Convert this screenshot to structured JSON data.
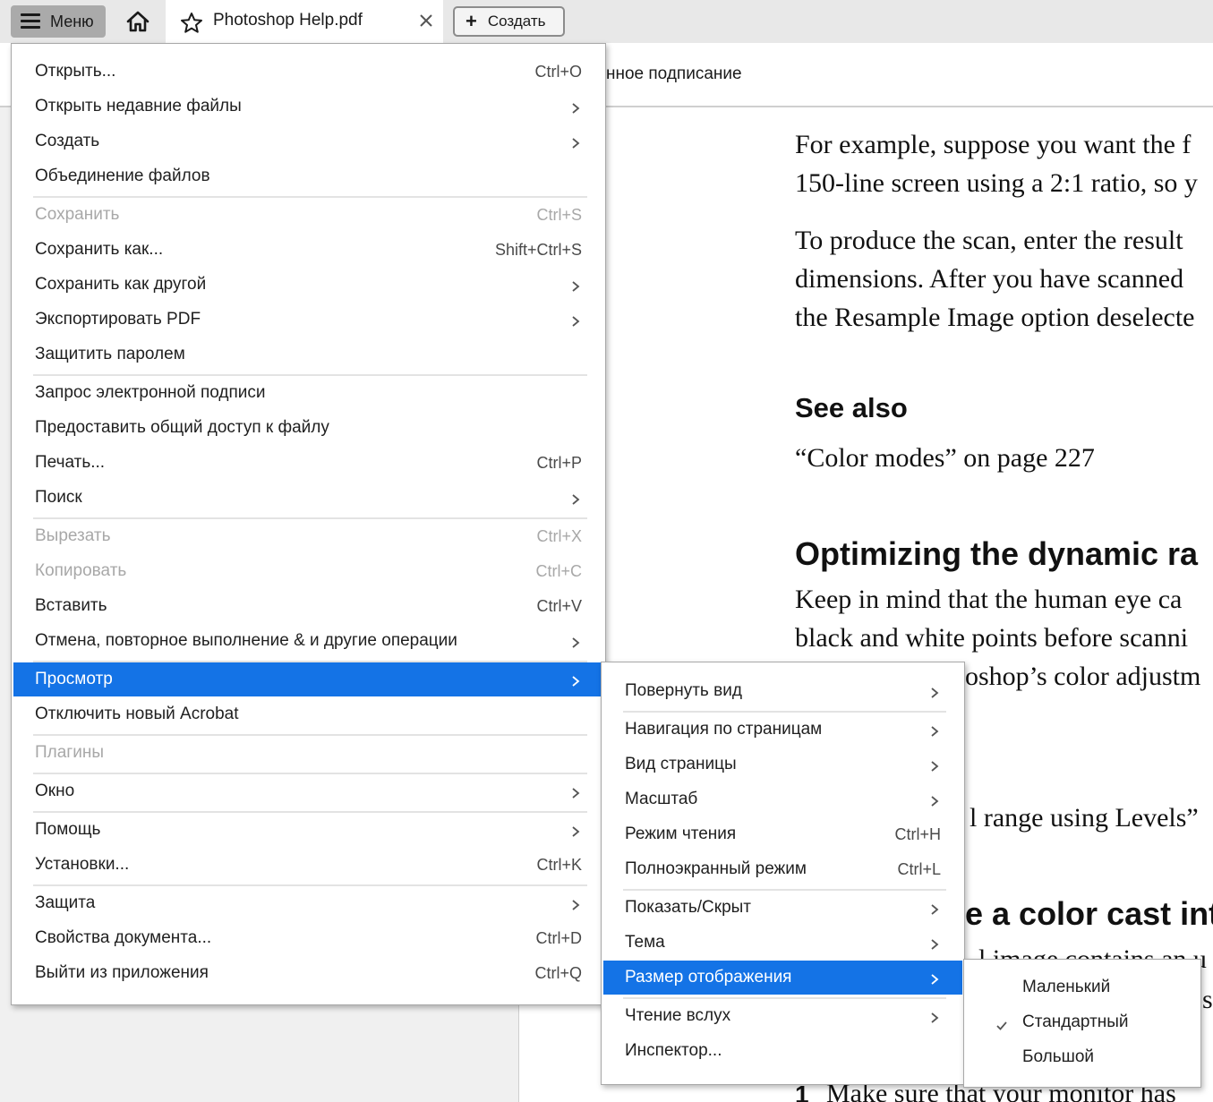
{
  "tabbar": {
    "menu_label": "Меню",
    "document_tab_title": "Photoshop Help.pdf",
    "create_label": "Создать"
  },
  "toolbar": {
    "partial_text": "нное подписание"
  },
  "document": {
    "para1_line1": "For example, suppose you want the f",
    "para1_line2": "150-line screen using a 2:1 ratio, so y",
    "para2_line1": "To produce the scan, enter the result",
    "para2_line2": "dimensions. After you have scanned",
    "para2_line3": "the Resample Image option deselecte",
    "see_also_heading": "See also",
    "see_also_link": "“Color modes” on page 227",
    "heading2": "Optimizing the dynamic ra",
    "para3_line1": "Keep in mind that the human eye ca",
    "para3_line2": "black and white points before scanni",
    "para3_line3": "oshop’s color adjustm",
    "partial_link": "l range using Levels”",
    "heading3_partial": "e a color cast int",
    "partial_line_a": "l image contains an u",
    "partial_line_b": "s",
    "step_number": "1",
    "step_text": "Make sure that your monitor has"
  },
  "main_menu": {
    "items": [
      {
        "label": "Открыть...",
        "shortcut": "Ctrl+O"
      },
      {
        "label": "Открыть недавние файлы",
        "submenu": true
      },
      {
        "label": "Создать",
        "submenu": true
      },
      {
        "label": "Объединение файлов"
      },
      {
        "label": "Сохранить",
        "shortcut": "Ctrl+S",
        "disabled": true
      },
      {
        "label": "Сохранить как...",
        "shortcut": "Shift+Ctrl+S"
      },
      {
        "label": "Сохранить как другой",
        "submenu": true
      },
      {
        "label": "Экспортировать PDF",
        "submenu": true
      },
      {
        "label": "Защитить паролем"
      },
      {
        "label": "Запрос электронной подписи"
      },
      {
        "label": "Предоставить общий доступ к файлу"
      },
      {
        "label": "Печать...",
        "shortcut": "Ctrl+P"
      },
      {
        "label": "Поиск",
        "submenu": true
      },
      {
        "label": "Вырезать",
        "shortcut": "Ctrl+X",
        "disabled": true
      },
      {
        "label": "Копировать",
        "shortcut": "Ctrl+C",
        "disabled": true
      },
      {
        "label": "Вставить",
        "shortcut": "Ctrl+V"
      },
      {
        "label": "Отмена, повторное выполнение & и другие операции",
        "submenu": true
      },
      {
        "label": "Просмотр",
        "submenu": true,
        "active": true
      },
      {
        "label": "Отключить новый Acrobat"
      },
      {
        "label": "Плагины",
        "disabled": true
      },
      {
        "label": "Окно",
        "submenu": true
      },
      {
        "label": "Помощь",
        "submenu": true
      },
      {
        "label": "Установки...",
        "shortcut": "Ctrl+K"
      },
      {
        "label": "Защита",
        "submenu": true
      },
      {
        "label": "Свойства документа...",
        "shortcut": "Ctrl+D"
      },
      {
        "label": "Выйти из приложения",
        "shortcut": "Ctrl+Q"
      }
    ]
  },
  "view_submenu": {
    "items": [
      {
        "label": "Повернуть вид",
        "submenu": true
      },
      {
        "label": "Навигация по страницам",
        "submenu": true
      },
      {
        "label": "Вид страницы",
        "submenu": true
      },
      {
        "label": "Масштаб",
        "submenu": true
      },
      {
        "label": "Режим чтения",
        "shortcut": "Ctrl+H"
      },
      {
        "label": "Полноэкранный режим",
        "shortcut": "Ctrl+L"
      },
      {
        "label": "Показать/Скрыт",
        "submenu": true
      },
      {
        "label": "Тема",
        "submenu": true
      },
      {
        "label": "Размер отображения",
        "submenu": true,
        "active": true
      },
      {
        "label": "Чтение вслух",
        "submenu": true
      },
      {
        "label": "Инспектор..."
      }
    ]
  },
  "size_submenu": {
    "items": [
      {
        "label": "Маленький"
      },
      {
        "label": "Стандартный",
        "checked": true
      },
      {
        "label": "Большой"
      }
    ]
  },
  "colors": {
    "accent": "#1473e6",
    "menu_button_bg": "#aaaaaa",
    "tabbar_bg": "#e8e8e8",
    "disabled_text": "#a8a8a8"
  }
}
